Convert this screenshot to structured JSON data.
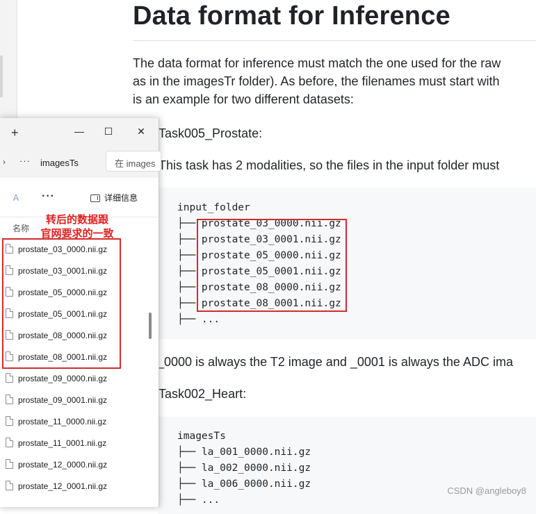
{
  "document": {
    "title": "Data format for Inference",
    "paragraph_lines": [
      "The data format for inference must match the one used for the raw",
      "as in the imagesTr folder). As before, the filenames must start with",
      "is an example for two different datasets:"
    ],
    "task1_heading": "Task005_Prostate:",
    "task1_text": "This task has 2 modalities, so the files in the input folder must",
    "task1_code": [
      "input_folder",
      "├── prostate_03_0000.nii.gz",
      "├── prostate_03_0001.nii.gz",
      "├── prostate_05_0000.nii.gz",
      "├── prostate_05_0001.nii.gz",
      "├── prostate_08_0000.nii.gz",
      "├── prostate_08_0001.nii.gz",
      "├── ..."
    ],
    "task1_note": "_0000 is always the T2 image and _0001 is always the ADC ima",
    "task2_heading": "Task002_Heart:",
    "task2_code": [
      "imagesTs",
      "├── la_001_0000.nii.gz",
      "├── la_002_0000.nii.gz",
      "├── la_006_0000.nii.gz",
      "├── ..."
    ]
  },
  "explorer": {
    "new_tab": "+",
    "minimize": "—",
    "maximize": "☐",
    "close": "✕",
    "nav_chevron": "›",
    "more_path": "···",
    "breadcrumb": "imagesTs",
    "search_placeholder": "在 images",
    "toolbar_more": "···",
    "details_label": "详细信息",
    "column_name": "名称",
    "files": [
      "prostate_03_0000.nii.gz",
      "prostate_03_0001.nii.gz",
      "prostate_05_0000.nii.gz",
      "prostate_05_0001.nii.gz",
      "prostate_08_0000.nii.gz",
      "prostate_08_0001.nii.gz",
      "prostate_09_0000.nii.gz",
      "prostate_09_0001.nii.gz",
      "prostate_11_0000.nii.gz",
      "prostate_11_0001.nii.gz",
      "prostate_12_0000.nii.gz",
      "prostate_12_0001.nii.gz"
    ]
  },
  "annotation": {
    "line1": "转后的数据跟",
    "line2": "官网要求的一致"
  },
  "watermark": "CSDN @angleboy8",
  "colors": {
    "highlight": "#d22b2b",
    "annotation": "#e02020",
    "code_bg": "#f6f8fa"
  }
}
